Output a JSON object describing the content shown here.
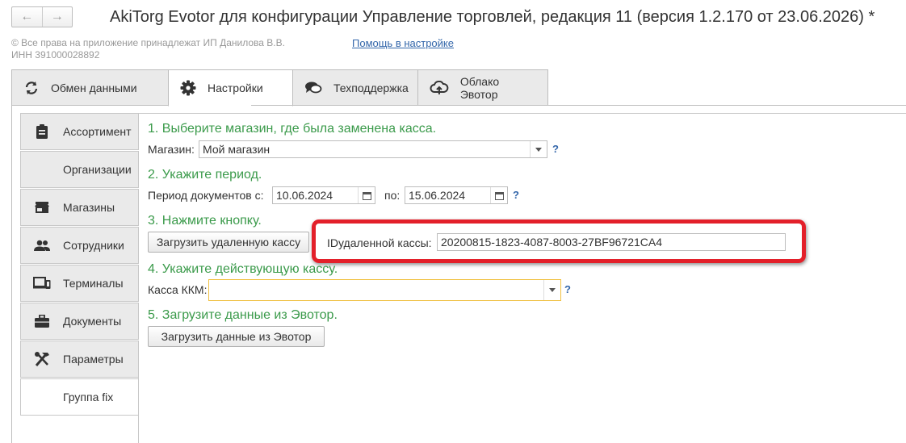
{
  "window": {
    "title": "AkiTorg Evotor для конфигурации Управление торговлей, редакция 11 (версия 1.2.170 от 23.06.2026) *",
    "back_glyph": "←",
    "forward_glyph": "→"
  },
  "header": {
    "copyright": "© Все права на приложение принадлежат ИП Данилова В.В.",
    "inn": "ИНН 391000028892",
    "help_link": "Помощь в настройке"
  },
  "tabs": [
    {
      "label": "Обмен данными",
      "icon": "sync-icon",
      "active": false
    },
    {
      "label": "Настройки",
      "icon": "gear-icon",
      "active": true
    },
    {
      "label": "Техподдержка",
      "icon": "chat-icon",
      "active": false
    },
    {
      "label": "Облако Эвотор",
      "icon": "cloud-upload-icon",
      "active": false
    }
  ],
  "sidebar": {
    "items": [
      {
        "label": "Ассортимент",
        "icon": "clipboard-icon"
      },
      {
        "label": "Организации",
        "icon": ""
      },
      {
        "label": "Магазины",
        "icon": "store-icon"
      },
      {
        "label": "Сотрудники",
        "icon": "people-icon"
      },
      {
        "label": "Терминалы",
        "icon": "devices-icon"
      },
      {
        "label": "Документы",
        "icon": "briefcase-icon"
      },
      {
        "label": "Параметры",
        "icon": "tools-icon"
      },
      {
        "label": "Группа fix",
        "icon": ""
      }
    ]
  },
  "form": {
    "step1": "1. Выберите магазин, где была заменена касса.",
    "store_label": "Магазин:",
    "store_value": "Мой магазин",
    "step2": "2. Укажите период.",
    "period_label": "Период  документов с:",
    "date_from": "10.06.2024",
    "to_label": "по:",
    "date_to": "15.06.2024",
    "step3": "3. Нажмите кнопку.",
    "load_remote_button": "Загрузить удаленную кассу",
    "id_label": "IDудаленной кассы:",
    "id_value": "20200815-1823-4087-8003-27BF96721CA4",
    "step4": "4. Укажите действующую кассу.",
    "kkm_label": "Касса ККМ:",
    "kkm_value": "",
    "step5": "5. Загрузите данные из Эвотор.",
    "load_data_button": "Загрузить данные из Эвотор",
    "help_glyph": "?"
  },
  "colors": {
    "step_text": "#3a9a4a",
    "link": "#3366aa",
    "highlight": "#e3202a",
    "focus_border": "#f0c040"
  }
}
